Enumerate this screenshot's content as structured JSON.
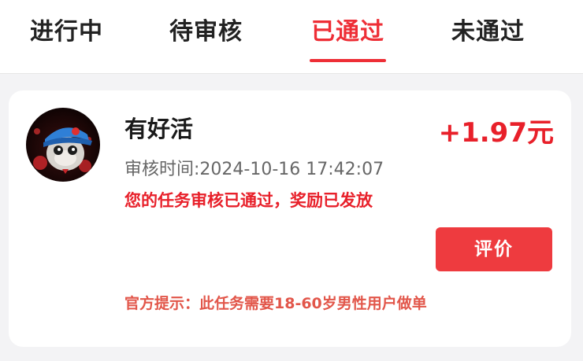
{
  "tabs": [
    {
      "label": "进行中",
      "active": false
    },
    {
      "label": "待审核",
      "active": false
    },
    {
      "label": "已通过",
      "active": true
    },
    {
      "label": "未通过",
      "active": false
    }
  ],
  "card": {
    "title": "有好活",
    "reward": "+1.97元",
    "review_time": "审核时间:2024-10-16 17:42:07",
    "status_message": "您的任务审核已通过，奖励已发放",
    "rate_button_label": "评价",
    "official_note": "官方提示：此任务需要18-60岁男性用户做单",
    "avatar_icon": "avatar-image"
  },
  "colors": {
    "accent": "#ee2e36",
    "button": "#ee3b3f",
    "note": "#e2564a",
    "background": "#f3f3f5"
  }
}
